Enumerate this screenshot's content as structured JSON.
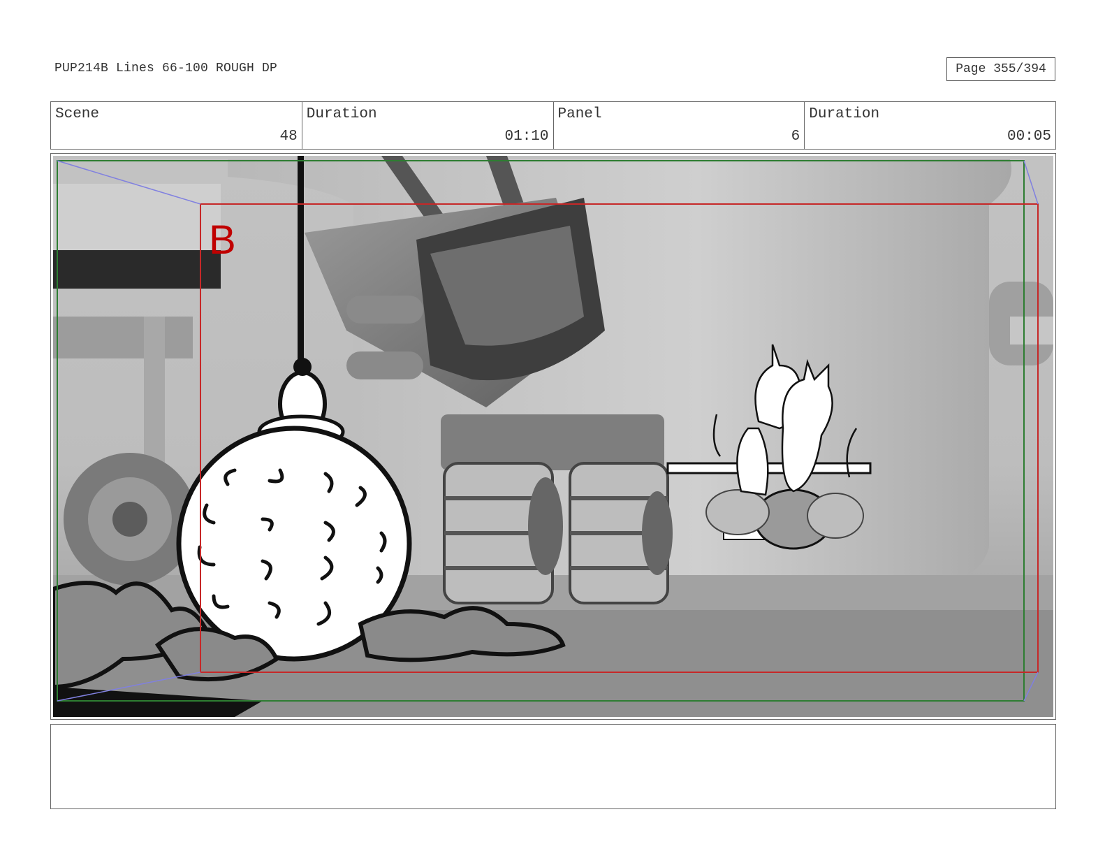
{
  "header": {
    "title": "PUP214B Lines 66-100 ROUGH DP",
    "page": "Page 355/394"
  },
  "info": [
    {
      "label": "Scene",
      "value": "48"
    },
    {
      "label": "Duration",
      "value": "01:10"
    },
    {
      "label": "Panel",
      "value": "6"
    },
    {
      "label": "Duration",
      "value": "00:05"
    }
  ],
  "panel": {
    "marker": "B",
    "colors": {
      "safe_frame": "#2e7d32",
      "action_frame": "#c62828",
      "camera_arrow": "#8080e0"
    }
  },
  "notes": {
    "text": ""
  }
}
